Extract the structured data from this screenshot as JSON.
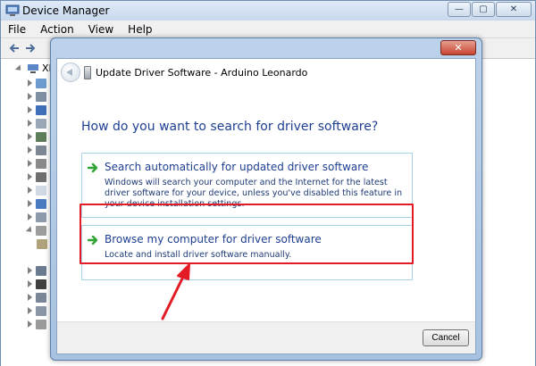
{
  "window": {
    "title": "Device Manager",
    "minimize": "—",
    "maximize": "▢",
    "close": "✕"
  },
  "menu": {
    "items": [
      "File",
      "Action",
      "View",
      "Help"
    ]
  },
  "tree": {
    "root_label": "XIA"
  },
  "dialog": {
    "title": "Update Driver Software - Arduino Leonardo",
    "close": "✕",
    "question": "How do you want to search for driver software?",
    "options": [
      {
        "title": "Search automatically for updated driver software",
        "description": "Windows will search your computer and the Internet for the latest driver software for your device, unless you've disabled this feature in your device installation settings."
      },
      {
        "title": "Browse my computer for driver software",
        "description": "Locate and install driver software manually."
      }
    ],
    "cancel_label": "Cancel"
  },
  "colors": {
    "link_blue": "#1e3f91",
    "highlight_red": "#e21b25",
    "option_border": "#a7d4ea",
    "arrow_green": "#2fa334"
  }
}
